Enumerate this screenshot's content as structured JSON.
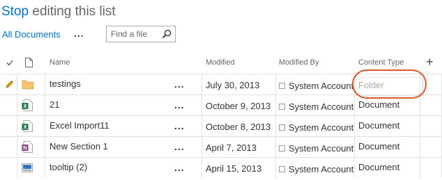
{
  "header": {
    "title_link": "Stop",
    "title_rest": " editing this list",
    "view_label": "All Documents",
    "more_label": "...",
    "search_placeholder": "Find a file"
  },
  "columns": {
    "name": "Name",
    "modified": "Modified",
    "modified_by": "Modified By",
    "content_type": "Content Type",
    "add": "+"
  },
  "rows": [
    {
      "name": "testings",
      "modified": "July 30, 2013",
      "modified_by": "System Account",
      "content_type": "Folder",
      "icon": "folder-icon"
    },
    {
      "name": "21",
      "modified": "October 9, 2013",
      "modified_by": "System Account",
      "content_type": "Document",
      "icon": "excel-icon"
    },
    {
      "name": "Excel Import11",
      "modified": "October 8, 2013",
      "modified_by": "System Account",
      "content_type": "Document",
      "icon": "excel-icon"
    },
    {
      "name": "New Section 1",
      "modified": "April 7, 2013",
      "modified_by": "System Account",
      "content_type": "Document",
      "icon": "onenote-icon"
    },
    {
      "name": "tooltip (2)",
      "modified": "April 15, 2013",
      "modified_by": "System Account",
      "content_type": "Document",
      "icon": "image-icon"
    }
  ],
  "row_more_label": "...",
  "colors": {
    "accent": "#0072c6",
    "highlight": "#d65a2b"
  }
}
